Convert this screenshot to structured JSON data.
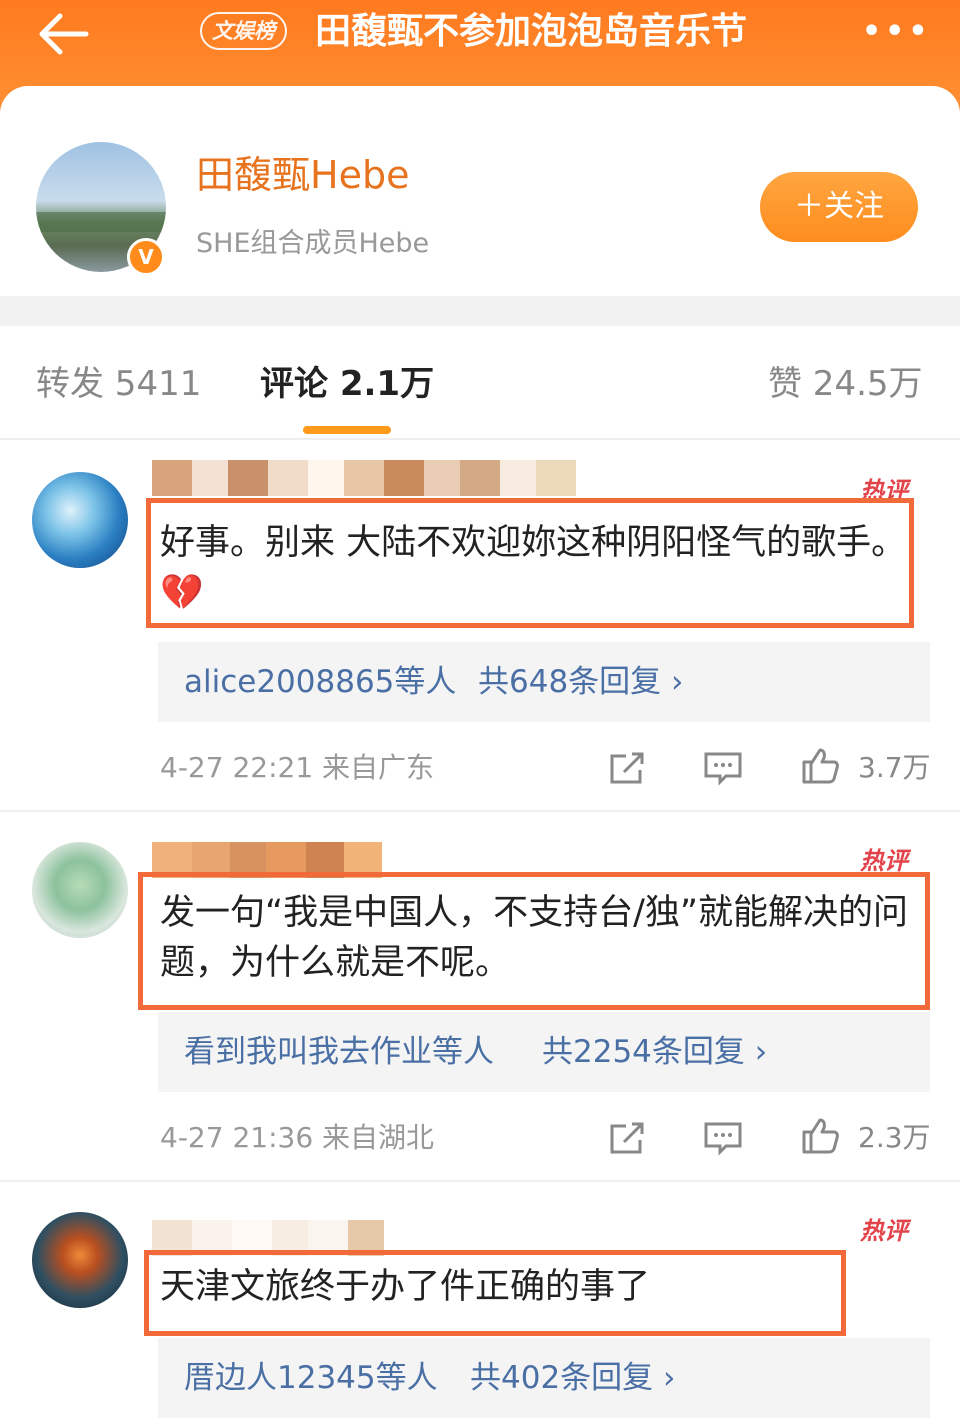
{
  "header": {
    "back_icon": "arrow-left-icon",
    "tag": "文娱榜",
    "title": "田馥甄不参加泡泡岛音乐节",
    "more_label": "•••"
  },
  "profile": {
    "name": "田馥甄Hebe",
    "description": "SHE组合成员Hebe",
    "verified_badge": "V",
    "follow_label": "＋关注"
  },
  "tabs": {
    "repost": "转发 5411",
    "comment": "评论 2.1万",
    "like": "赞 24.5万"
  },
  "comments": [
    {
      "hot_label": "热评",
      "text": "好事。别来 大陆不欢迎妳这种阴阳怪气的歌手。",
      "emoji": "💔",
      "reply_users": "alice2008865等人",
      "reply_count": "共648条回复 ›",
      "meta": "4-27 22:21  来自广东",
      "likes": "3.7万"
    },
    {
      "hot_label": "热评",
      "text": "发一句“我是中国人，不支持台/独”就能解决的问题，为什么就是不呢。",
      "reply_users": "看到我叫我去作业等人",
      "reply_count": "共2254条回复 ›",
      "meta": "4-27 21:36  来自湖北",
      "likes": "2.3万"
    },
    {
      "hot_label": "热评",
      "text": "天津文旅终于办了件正确的事了",
      "reply_users": "厝边人12345等人",
      "reply_count": "共402条回复 ›"
    }
  ],
  "colors": {
    "header_orange": "#ff7a1f",
    "accent_orange": "#ff9a1a",
    "highlight_box": "#f26a3a",
    "link_blue": "#4a6fa5",
    "hot_red": "#e2434a"
  }
}
